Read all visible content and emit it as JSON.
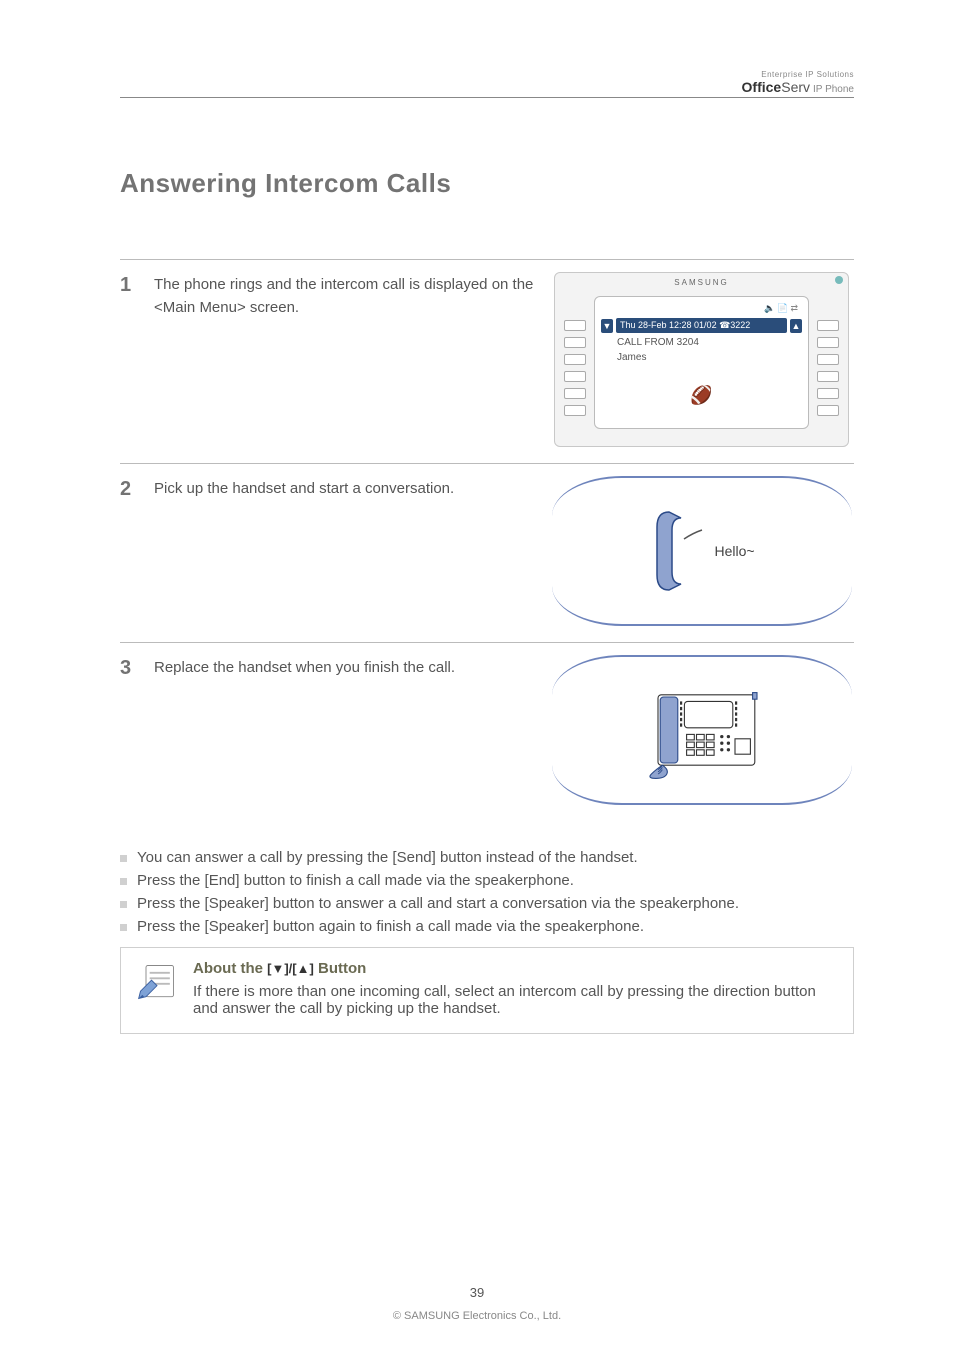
{
  "header": {
    "brand_super": "Enterprise IP Solutions",
    "brand_office": "Office",
    "brand_serv": "Serv",
    "brand_sub": "IP Phone"
  },
  "chapter_title": "Answering Intercom Calls",
  "steps": [
    {
      "num": "1",
      "text_1": "The phone rings and the intercom call is displayed on the ",
      "text_em": "<Main Menu>",
      "text_2": " screen.",
      "lcd": {
        "logo": "SAMSUNG",
        "icons": [
          "🔈",
          "📄",
          "⇄"
        ],
        "hl_text": "Thu 28-Feb 12:28 01/02  ☎3222",
        "line2": "CALL FROM 3204",
        "line3": "James"
      }
    },
    {
      "num": "2",
      "text_1": "Pick up the handset and start a conversation.",
      "hello": "Hello~"
    },
    {
      "num": "3",
      "text_1": "Replace the handset when you finish the call."
    }
  ],
  "bullets": [
    "You can answer a call by pressing the [Send] button instead of the handset.",
    "Press the [End] button to finish a call made via the speakerphone.",
    "Press the [Speaker] button to answer a call and start a conversation via the speakerphone.",
    "Press the [Speaker] button again to finish a call made via the speakerphone."
  ],
  "note": {
    "title_prefix": "About the ",
    "title_mid": "[▼]/[▲]",
    "title_suffix": " Button",
    "body": "If there is more than one incoming call, select an intercom call by pressing the direction button and answer the call by picking up the handset."
  },
  "footer": {
    "page": "39",
    "copyright": "© SAMSUNG Electronics Co., Ltd."
  }
}
